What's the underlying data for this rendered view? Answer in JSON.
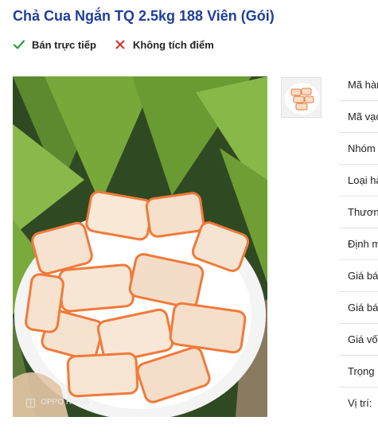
{
  "product": {
    "title": "Chả Cua Ngắn TQ 2.5kg 188 Viên (Gói)"
  },
  "flags": [
    {
      "label": "Bán trực tiếp",
      "icon": "check-icon",
      "color": "#2e9e3e"
    },
    {
      "label": "Không tích điểm",
      "icon": "x-icon",
      "color": "#d0312d"
    }
  ],
  "image": {
    "watermark": "OPPO Reno5"
  },
  "specs": [
    {
      "label": "Mã hàng"
    },
    {
      "label": "Mã vạch"
    },
    {
      "label": "Nhóm"
    },
    {
      "label": "Loại hàng"
    },
    {
      "label": "Thương"
    },
    {
      "label": "Định m"
    },
    {
      "label": "Giá bán"
    },
    {
      "label": "Giá bán"
    },
    {
      "label": "Giá vốn"
    },
    {
      "label": "Trọng"
    },
    {
      "label": "Vị trí:"
    }
  ]
}
